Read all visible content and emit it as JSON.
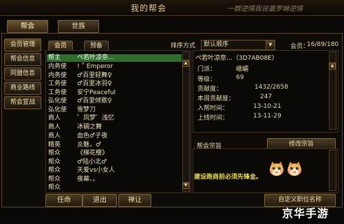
{
  "window": {
    "title": "我的帮会",
    "banner_right": "一群逆情我说最罗琳逆情"
  },
  "top_tabs": [
    {
      "label": "帮会"
    },
    {
      "label": "世族"
    }
  ],
  "sidebar": {
    "items": [
      {
        "label": "会员管理"
      },
      {
        "label": "帮会信息"
      },
      {
        "label": "同盟信息"
      },
      {
        "label": "商业路线"
      },
      {
        "label": "帮会宣战"
      }
    ]
  },
  "member_tabs": [
    {
      "label": "会员"
    },
    {
      "label": "预备"
    }
  ],
  "sort": {
    "label": "排序方式",
    "value": "默认顺序"
  },
  "member_count": {
    "label": "会员：",
    "value": "16/89/180"
  },
  "members": [
    {
      "position": "帮主",
      "name": "ぺ若叶凉奈…"
    },
    {
      "position": "内务使",
      "name": "! ˚ Emperor"
    },
    {
      "position": "内务使",
      "name": "♂百里轻舞♀"
    },
    {
      "position": "工务使",
      "name": "♂百里冰羽♀"
    },
    {
      "position": "工务使",
      "name": "安宁Peaceful"
    },
    {
      "position": "弘化使",
      "name": "♂百里倾歌♀"
    },
    {
      "position": "弘化使",
      "name": "雪梦刀"
    },
    {
      "position": "商人",
      "name": "゜凤梦゜浅忆"
    },
    {
      "position": "商人",
      "name": "冰碉之舞"
    },
    {
      "position": "商人",
      "name": "血色♂子夜"
    },
    {
      "position": "精英",
      "name": "炎魅，♂"
    },
    {
      "position": "帮众",
      "name": "《梯花樱》"
    },
    {
      "position": "帮众",
      "name": "♂陆小北♂"
    },
    {
      "position": "帮众",
      "name": "天爱vs小女人"
    },
    {
      "position": "帮众",
      "name": "夜幕、。"
    },
    {
      "position": "帮众",
      "name": ""
    }
  ],
  "selected_member": {
    "name": "ぺ若叶凉奈…（3D7AB08E）",
    "fields": [
      {
        "label": "门派：",
        "value": "峨嵋"
      },
      {
        "label": "等级：",
        "value": "69"
      },
      {
        "label": "贡献度：",
        "value": "1432/2658"
      },
      {
        "label": "本周贡献度：",
        "value": "247"
      },
      {
        "label": "入帮时间：",
        "value": "13-10-21"
      },
      {
        "label": "上线时间：",
        "value": "13-11-29"
      }
    ]
  },
  "guild_motto": {
    "title": "帮会宗旨",
    "edit_label": "修改宗旨",
    "text": "建设跑商前必须先锋金。"
  },
  "bottom_buttons": {
    "appoint": "任命",
    "leave": "退出",
    "transfer": "禅让",
    "custom_rank": "自定义职位名称"
  },
  "watermark": "京华手游",
  "colors": {
    "selected_row": "#2e6e2c",
    "gold_border": "#7a6136",
    "announce_text": "#e8d84a"
  }
}
